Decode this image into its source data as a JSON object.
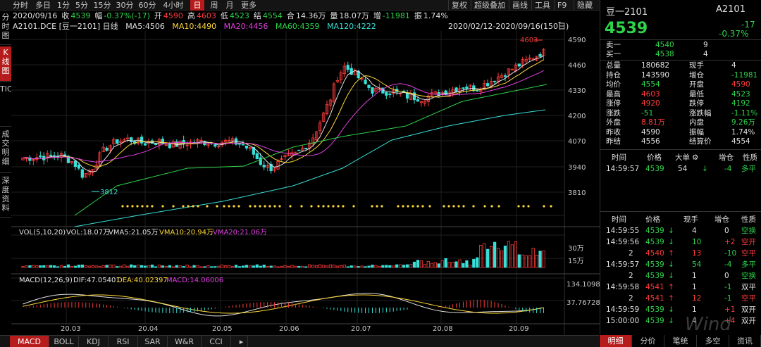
{
  "toolbar": {
    "periods": [
      "分时",
      "多日",
      "1分",
      "5分",
      "15分",
      "30分",
      "60分",
      "4小时",
      "日",
      "周",
      "月",
      "更多"
    ],
    "active": "日",
    "tools": [
      "复权",
      "超级叠加",
      "画线",
      "工具",
      "F9",
      "隐藏"
    ]
  },
  "side_tabs": [
    "分时图",
    "K线图",
    "TICK",
    "成交明细",
    "深度资料"
  ],
  "info_bar": {
    "date": "2020/09/16",
    "close_label": "收",
    "close": "4539",
    "change_label": "幅",
    "change": "-0.37%(-17)",
    "open_label": "开",
    "open": "4590",
    "high_label": "高",
    "high": "4603",
    "low_label": "低",
    "low": "4523",
    "settle_label": "结",
    "settle": "4554",
    "amount_label": "合",
    "amount": "14.36万",
    "volume_label": "量",
    "volume": "18.07万",
    "oi_label": "增",
    "oi": "-11981",
    "amp_label": "振",
    "amp": "1.74%"
  },
  "legend": {
    "symbol": "A2101.DCE [豆一2101] 日线",
    "ma5": "MA5:4506",
    "ma10": "MA10:4490",
    "ma20": "MA20:4456",
    "ma60": "MA60:4359",
    "ma120": "MA120:4222",
    "range": "2020/02/12-2020/09/16(150日)"
  },
  "price_axis": [
    "4590",
    "4460",
    "4330",
    "4200",
    "4070",
    "3940",
    "3810"
  ],
  "annotations": {
    "high_mark": "4603",
    "low_mark": "3812"
  },
  "vol_legend": {
    "title": "VOL(5,10,20)",
    "vol": "VOL:18.07万",
    "vma5": "VMA5:21.05万",
    "vma10": "VMA10:20.94万",
    "vma20": "VMA20:21.06万"
  },
  "vol_axis": [
    "30万",
    "15万"
  ],
  "macd_legend": {
    "title": "MACD(12,26,9)",
    "dif": "DIF:47.05401",
    "dea": "DEA:40.02397",
    "macd": "MACD:14.06006"
  },
  "macd_axis": [
    "134.1098",
    "37.76728"
  ],
  "dates": [
    "20.03",
    "20.04",
    "20.05",
    "20.06",
    "20.07",
    "20.08",
    "20.09"
  ],
  "bottom_tabs": [
    "MACD",
    "BOLL",
    "KDJ",
    "RSI",
    "SAR",
    "W&R",
    "CCI"
  ],
  "right": {
    "name": "豆一2101",
    "code": "A2101",
    "price": "4539",
    "change": "-17",
    "change_pct": "-0.37%",
    "sell1_label": "卖一",
    "sell1_price": "4540",
    "sell1_vol": "9",
    "buy1_label": "买一",
    "buy1_price": "4538",
    "buy1_vol": "4",
    "stats": [
      [
        "总量",
        "180682",
        "现手",
        "4"
      ],
      [
        "持仓",
        "143590",
        "增仓",
        "-11981"
      ],
      [
        "均价",
        "4554",
        "开盘",
        "4590"
      ],
      [
        "最高",
        "4603",
        "最低",
        "4523"
      ],
      [
        "涨停",
        "4920",
        "跌停",
        "4192"
      ],
      [
        "涨跌",
        "-51",
        "涨跌幅",
        "-1.11%"
      ],
      [
        "外盘",
        "8.81万",
        "内盘",
        "9.26万"
      ],
      [
        "昨收",
        "4590",
        "振幅",
        "1.74%"
      ],
      [
        "昨结",
        "4556",
        "结算价",
        "4554"
      ]
    ],
    "table_head": [
      "时间",
      "价格",
      "大单",
      "增仓",
      "性质"
    ],
    "big_trade": [
      "14:59:57",
      "4539",
      "54",
      "-4",
      "多平"
    ],
    "tick_head": [
      "时间",
      "价格",
      "现手",
      "增仓",
      "性质"
    ],
    "ticks": [
      [
        "14:59:55",
        "4539",
        "4",
        "0",
        "空换"
      ],
      [
        "14:59:56",
        "4539",
        "10",
        "+2",
        "空开"
      ],
      [
        "2",
        "4540",
        "13",
        "-10",
        "空平"
      ],
      [
        "14:59:57",
        "4539",
        "54",
        "-4",
        "多平"
      ],
      [
        "2",
        "4539",
        "1",
        "0",
        "空换"
      ],
      [
        "14:59:58",
        "4541",
        "1",
        "-1",
        "双平"
      ],
      [
        "2",
        "4541",
        "12",
        "-1",
        "空平"
      ],
      [
        "14:59:59",
        "4539",
        "1",
        "+1",
        "双开"
      ],
      [
        "15:00:00",
        "4539",
        "4",
        "+4",
        "双开"
      ]
    ],
    "tabs": [
      "明细",
      "分价",
      "笔统",
      "多空",
      "资讯"
    ]
  },
  "watermark": "Wind",
  "colors": {
    "up": "#ff3b3b",
    "down": "#37e0d8",
    "ma5": "#e0e0e0",
    "ma10": "#ffd83a",
    "ma20": "#e040e0",
    "ma60": "#2fd34a",
    "ma120": "#37e0d8",
    "active": "#b71c1c"
  }
}
